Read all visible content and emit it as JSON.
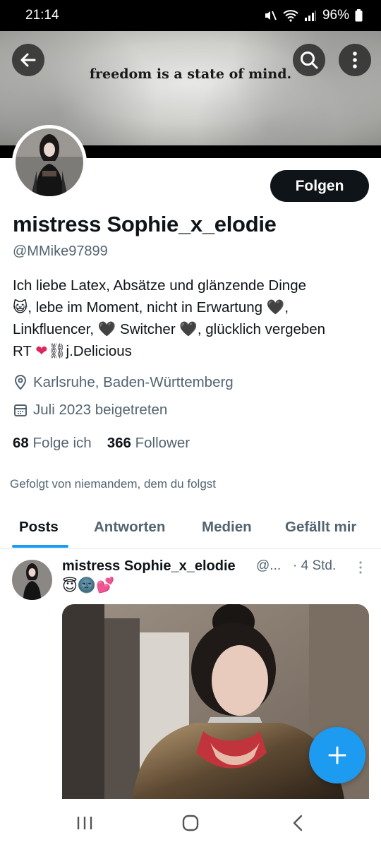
{
  "status_bar": {
    "time": "21:14",
    "battery": "96%"
  },
  "banner": {
    "quote": "freedom is a state of mind."
  },
  "profile": {
    "follow_label": "Folgen",
    "display_name": "mistress Sophie_x_elodie",
    "handle": "@MMike97899",
    "bio_lines": [
      "Ich liebe Latex, Absätze und glänzende Dinge",
      ", lebe im Moment, nicht in Erwartung",
      "Linkfluencer,",
      "Switcher",
      ", glücklich vergeben",
      "RT",
      "j.Delicious"
    ],
    "location": "Karlsruhe, Baden-Württemberg",
    "joined": "Juli 2023 beigetreten",
    "following_count": "68",
    "following_label": "Folge ich",
    "followers_count": "366",
    "followers_label": "Follower",
    "followed_by": "Gefolgt von niemandem, dem du folgst"
  },
  "tabs": [
    {
      "label": "Posts",
      "active": true
    },
    {
      "label": "Antworten",
      "active": false
    },
    {
      "label": "Medien",
      "active": false
    },
    {
      "label": "Gefällt mir",
      "active": false
    }
  ],
  "post": {
    "author": "mistress Sophie_x_elodie",
    "handle": "@...",
    "time": "· 4 Std.",
    "emoji": [
      "😇",
      "🌚",
      "💕"
    ]
  },
  "icons": {
    "back": "arrow-left-icon",
    "search": "search-icon",
    "more": "more-vertical-icon",
    "location": "location-pin-icon",
    "calendar": "calendar-icon",
    "compose": "plus-icon"
  },
  "colors": {
    "accent": "#1d9bf0",
    "text": "#0f1419",
    "secondary": "#536471",
    "heart_red": "#e0245e"
  }
}
